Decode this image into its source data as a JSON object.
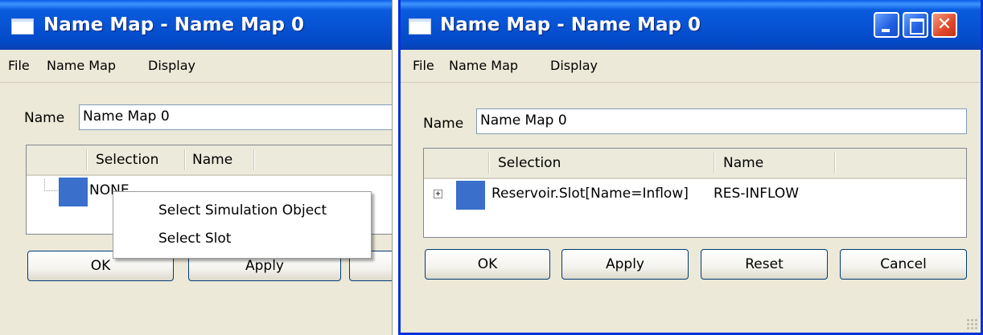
{
  "left_window": {
    "title": "Name Map - Name Map 0",
    "menu": [
      "File",
      "Name Map",
      "Display"
    ],
    "name_label": "Name",
    "name_value": "Name Map 0",
    "columns": [
      "Selection",
      "Name"
    ],
    "row": {
      "selection": "NONE",
      "name": ""
    },
    "buttons": [
      "OK",
      "Apply"
    ],
    "context_menu": [
      "Select Simulation Object",
      "Select Slot"
    ]
  },
  "right_window": {
    "title": "Name Map - Name Map 0",
    "menu": [
      "File",
      "Name Map",
      "Display"
    ],
    "name_label": "Name",
    "name_value": "Name Map 0",
    "columns": [
      "Selection",
      "Name"
    ],
    "row": {
      "expander": "+",
      "selection": "Reservoir.Slot[Name=Inflow]",
      "name": "RES-INFLOW"
    },
    "buttons": [
      "OK",
      "Apply",
      "Reset",
      "Cancel"
    ]
  },
  "colors": {
    "titlebar": "#0652d2",
    "window_bg": "#ece9d8",
    "object_icon": "#3a6fcb",
    "close_button": "#e0472b"
  },
  "icons": [
    "window-icon",
    "object-icon",
    "expand-plus-icon",
    "minimize-icon",
    "maximize-icon",
    "close-icon",
    "resize-grip-icon"
  ]
}
